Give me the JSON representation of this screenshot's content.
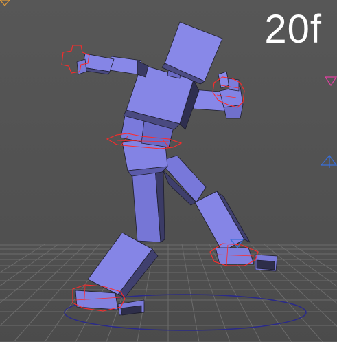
{
  "viewport": {
    "frame_label": "20f",
    "colors": {
      "background": "#555555",
      "grid": "#6a6a6a",
      "figure_face_light": "#8585e6",
      "figure_face_mid": "#6e6ec9",
      "figure_face_dark": "#2e2e4a",
      "control_handle": "#ff2a2a",
      "ground_ring": "#2a2a8a",
      "marker_blue": "#3a6fd8",
      "marker_magenta": "#e040a0"
    },
    "icons": [
      "camera-marker-icon",
      "target-marker-icon",
      "ground-circle-icon"
    ]
  }
}
